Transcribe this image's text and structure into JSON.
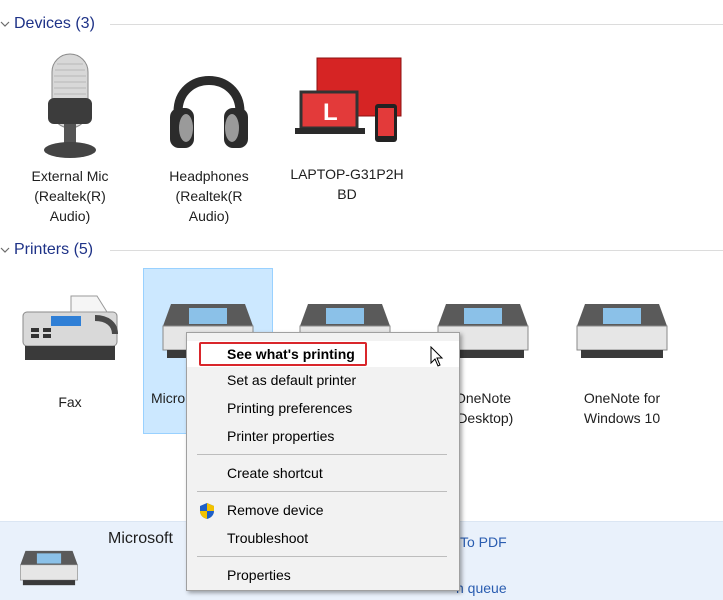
{
  "devices_section": {
    "title": "Devices (3)"
  },
  "devices": [
    {
      "name": "External Mic\n(Realtek(R)\nAudio)",
      "icon": "microphone-icon"
    },
    {
      "name": "Headphones\n(Realtek(R\nAudio)",
      "icon": "headphones-icon"
    },
    {
      "name": "LAPTOP-G31P2H\nBD",
      "icon": "laptop-icon"
    }
  ],
  "printers_section": {
    "title": "Printers (5)"
  },
  "printers": [
    {
      "name": "Fax",
      "icon": "fax-icon"
    },
    {
      "name": "Micro",
      "icon": "printer-icon",
      "selected": true
    },
    {
      "name": "",
      "icon": "printer-icon"
    },
    {
      "name": "OneNote\n(Desktop)",
      "icon": "printer-icon"
    },
    {
      "name": "OneNote for\nWindows 10",
      "icon": "printer-icon"
    }
  ],
  "details": {
    "name": "Microsoft",
    "line1": "To PDF",
    "line2": "n queue"
  },
  "context_menu": {
    "items": [
      {
        "label": "See what's printing",
        "bold": true,
        "highlighted": true
      },
      {
        "label": "Set as default printer"
      },
      {
        "label": "Printing preferences"
      },
      {
        "label": "Printer properties"
      },
      {
        "label": "Create shortcut"
      },
      {
        "label": "Remove device",
        "icon": "shield-icon"
      },
      {
        "label": "Troubleshoot"
      },
      {
        "label": "Properties"
      }
    ]
  },
  "colors": {
    "accent": "#1e3287",
    "selection": "#cce8ff",
    "focus_border": "#d9262b",
    "menu_bg": "#f2f2f2"
  }
}
